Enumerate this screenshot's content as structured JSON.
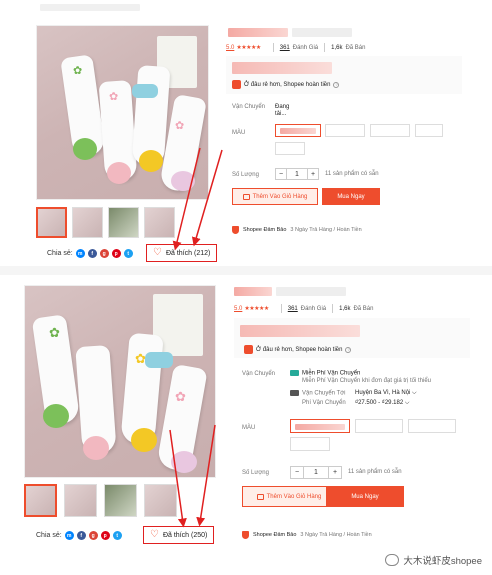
{
  "top": {
    "rating": {
      "score": "5.0",
      "stars": "★★★★★",
      "review_count": "361",
      "review_label": "Đánh Giá",
      "sold_count": "1,6k",
      "sold_label": "Đã Bán"
    },
    "cheaper_text": "Ở đâu rẻ hơn, Shopee hoàn tiền",
    "shipping_label": "Vận Chuyển",
    "shipping_value_1": "Đang",
    "shipping_value_2": "tải...",
    "variant_label": "MÀU",
    "quantity_label": "Số Lượng",
    "quantity_minus": "−",
    "quantity_value": "1",
    "quantity_plus": "+",
    "stock_text": "11 sản phẩm có sẵn",
    "add_to_cart": "Thêm Vào Giỏ Hàng",
    "buy_now": "Mua Ngay",
    "guarantee": "Shopee Đảm Bảo",
    "guarantee_detail": "3 Ngày Trả Hàng / Hoàn Tiền",
    "share_label": "Chia sẻ:",
    "like_label": "Đã thích (212)"
  },
  "bottom": {
    "rating": {
      "score": "5.0",
      "stars": "★★★★★",
      "review_count": "361",
      "review_label": "Đánh Giá",
      "sold_count": "1,6k",
      "sold_label": "Đã Bán"
    },
    "cheaper_text": "Ở đâu rẻ hơn, Shopee hoàn tiền",
    "shipping_label": "Vận Chuyển",
    "free_ship": "Miễn Phí Vận Chuyển",
    "free_ship_detail": "Miễn Phí Vận Chuyển khi đơn đạt giá trị tối thiểu",
    "ship_to_label": "Vận Chuyển Tới",
    "ship_to_value": "Huyện Ba Vì, Hà Nội",
    "ship_fee_label": "Phí Vận Chuyển",
    "ship_fee_value": "₫27.500 - ₫29.182",
    "variant_label": "MÀU",
    "quantity_label": "Số Lượng",
    "quantity_minus": "−",
    "quantity_value": "1",
    "quantity_plus": "+",
    "stock_text": "11 sản phẩm có sẵn",
    "add_to_cart": "Thêm Vào Giỏ Hàng",
    "buy_now": "Mua Ngay",
    "guarantee": "Shopee Đảm Bảo",
    "guarantee_detail": "3 Ngày Trả Hàng / Hoàn Tiền",
    "share_label": "Chia sẻ:",
    "like_label": "Đã thích (250)"
  },
  "watermark": "大木说虾皮shopee",
  "colors": {
    "accent": "#ee4d2d",
    "arrow": "#e02020",
    "teal": "#26aa99"
  },
  "icons": [
    "heart-icon",
    "messenger-icon",
    "facebook-icon",
    "google-plus-icon",
    "pinterest-icon",
    "twitter-icon",
    "truck-icon",
    "cart-icon",
    "shield-icon",
    "info-icon",
    "chevron-down-icon",
    "wechat-icon"
  ]
}
